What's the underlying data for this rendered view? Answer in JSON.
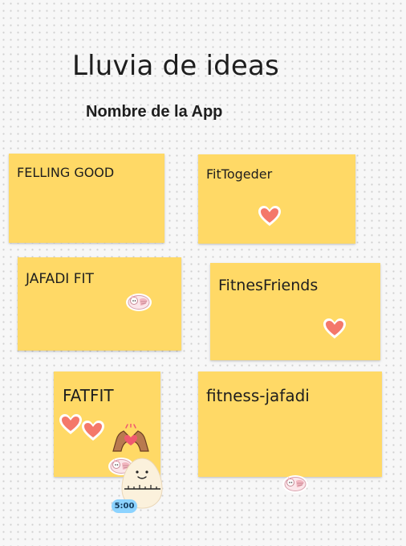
{
  "board": {
    "title": "Lluvia de ideas",
    "subtitle": "Nombre de la App"
  },
  "notes": [
    {
      "text": "FELLING GOOD"
    },
    {
      "text": "FitTogeder"
    },
    {
      "text": "JAFADI FIT"
    },
    {
      "text": "FitnesFriends"
    },
    {
      "text": "FATFIT"
    },
    {
      "text": "fitness-jafadi"
    }
  ],
  "stickers": {
    "heart_icon": "heart-icon",
    "cat_icon": "cat-sticker-icon",
    "hands_icon": "heart-hands-icon",
    "timer_icon": "egg-timer-icon"
  },
  "timer": {
    "label": "5:00"
  },
  "colors": {
    "note": "#ffd966",
    "heart": "#f4786a",
    "badge": "#8cd3ff"
  }
}
